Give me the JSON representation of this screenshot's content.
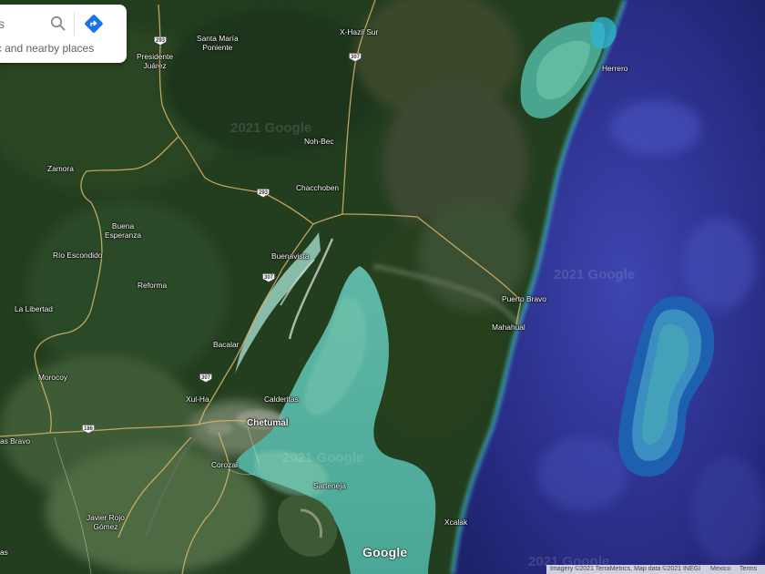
{
  "search": {
    "value": "s",
    "hint": "affic and nearby places",
    "search_icon": "search-icon",
    "directions_icon": "directions-icon"
  },
  "places": {
    "x_hazil_sur": "X-Hazil Sur",
    "santa_maria_poniente": "Santa María\nPoniente",
    "presidente_juarez": "Presidente\nJuárez",
    "herrero": "Herrero",
    "noh_bec": "Noh-Bec",
    "zamora": "Zamora",
    "chacchoben": "Chacchoben",
    "buena_esperanza": "Buena\nEsperanza",
    "rio_escondido": "Río Escondido",
    "buenavista": "Buenavista",
    "reforma": "Reforma",
    "puerto_bravo": "Puerto Bravo",
    "la_libertad": "La Libertad",
    "mahahual": "Mahahual",
    "bacalar": "Bacalar",
    "morocoy": "Morocoy",
    "xul_ha": "Xul-Ha",
    "calderitas": "Calderitas",
    "chetumal": "Chetumal",
    "as_bravo": "as Bravo",
    "corozal": "Corozal",
    "sarteneja": "Sarteneja",
    "javier_rojo_gomez": "Javier Rojo\nGómez",
    "xcalak": "Xcalak",
    "as": "as"
  },
  "shields": {
    "r293_north": "293",
    "r307_north": "307",
    "r293_mid": "293",
    "r307_mid": "307",
    "r307_south": "307",
    "r186": "186"
  },
  "watermarks": [
    "2021 Google",
    "2021 Google",
    "2021 Google",
    "2021 Google"
  ],
  "google_logo": "Google",
  "attribution": {
    "imagery": "Imagery ©2021 TerraMetrics, Map data ©2021 INEGI",
    "country": "Mexico",
    "terms": "Terms"
  }
}
